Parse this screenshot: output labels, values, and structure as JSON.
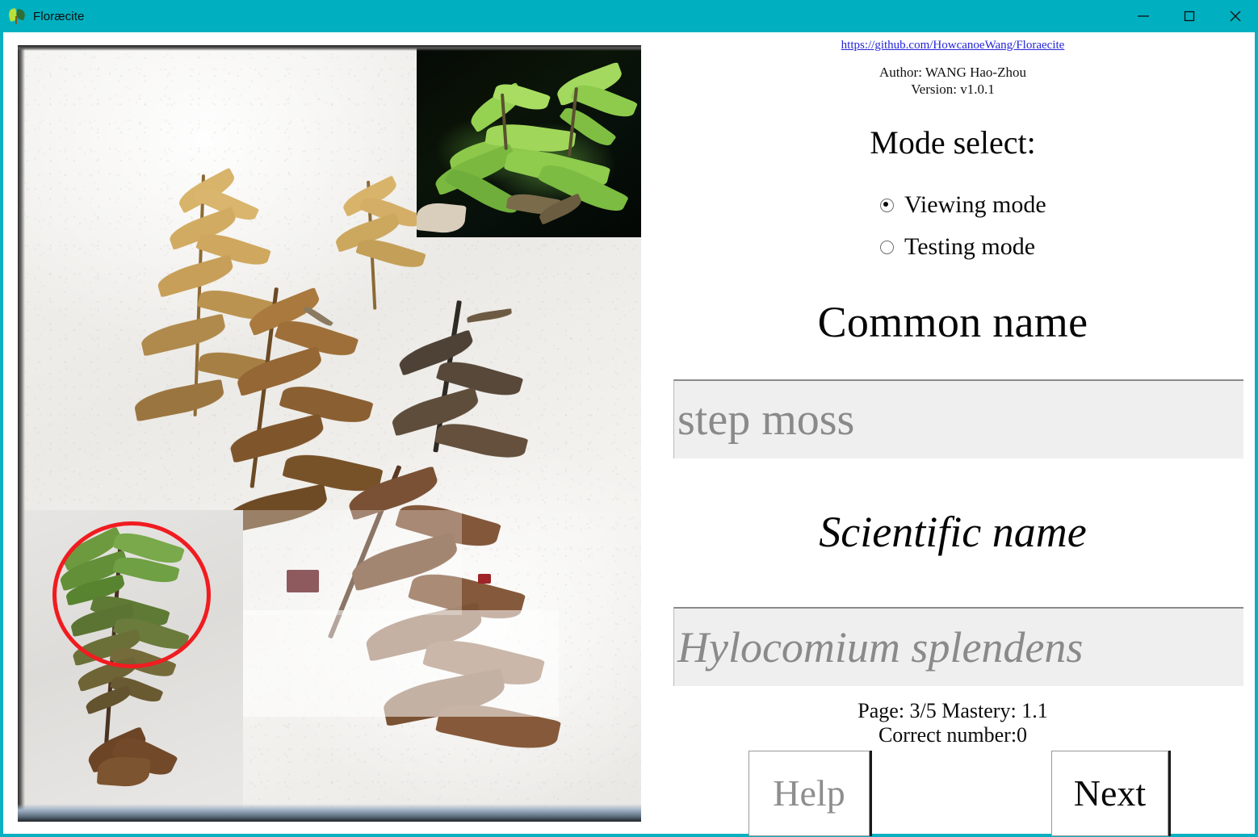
{
  "window": {
    "title": "Floræcite",
    "icon": "sprout-icon",
    "accent_color": "#00b0c0",
    "controls": {
      "minimize": "minimize-icon",
      "maximize": "maximize-icon",
      "close": "close-icon"
    }
  },
  "info": {
    "repo_url": "https://github.com/HowcanoeWang/Floraecite",
    "author": "Author: WANG Hao-Zhou",
    "version": "Version: v1.0.1",
    "mode_heading": "Mode select:",
    "modes": [
      {
        "label": "Viewing mode",
        "selected": true
      },
      {
        "label": "Testing mode",
        "selected": false
      }
    ],
    "common_name_heading": "Common name",
    "common_name_value": "step moss",
    "scientific_name_heading": "Scientific name",
    "scientific_name_value": "Hylocomium splendens",
    "status_page": "Page: 3/5  Mastery: 1.1",
    "status_correct": "Correct number:0",
    "help_label": "Help",
    "next_label": "Next"
  },
  "specimen": {
    "description": "Herbarium sheet with pressed Hylocomium splendens moss",
    "inset_top_right": "field photo of green moss",
    "inset_bottom_left": "single moss shoot with red circle annotation",
    "annotation_color": "#f01c20"
  }
}
